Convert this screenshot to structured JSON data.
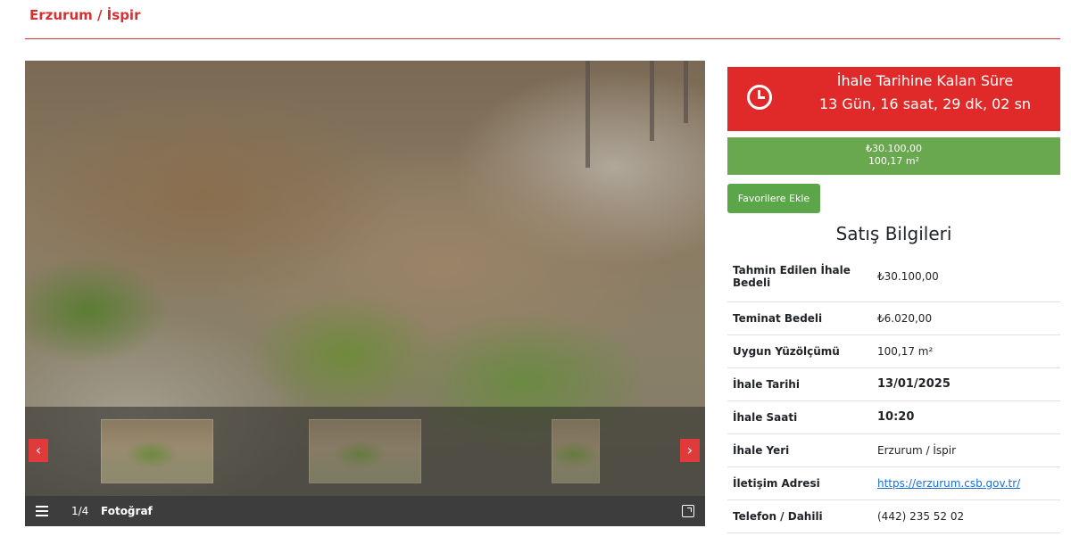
{
  "header": {
    "title": "Erzurum / İspir"
  },
  "gallery": {
    "counter": "1/4",
    "label": "Fotoğraf",
    "prev_icon": "‹",
    "next_icon": "›"
  },
  "countdown": {
    "title": "İhale Tarihine Kalan Süre",
    "time": "13 Gün, 16 saat, 29 dk, 02 sn"
  },
  "price": {
    "amount": "₺30.100,00",
    "area": "100,17 m²"
  },
  "favorite_button": {
    "label": "Favorilere Ekle"
  },
  "sale_info": {
    "title": "Satış Bilgileri",
    "rows": [
      {
        "key": "Tahmin Edilen İhale Bedeli",
        "value": "₺30.100,00"
      },
      {
        "key": "Teminat Bedeli",
        "value": "₺6.020,00"
      },
      {
        "key": "Uygun Yüzölçümü",
        "value": "100,17 m²"
      },
      {
        "key": "İhale Tarihi",
        "value": "13/01/2025"
      },
      {
        "key": "İhale Saati",
        "value": "10:20"
      },
      {
        "key": "İhale Yeri",
        "value": "Erzurum / İspir"
      },
      {
        "key": "İletişim Adresi",
        "value": "https://erzurum.csb.gov.tr/"
      },
      {
        "key": "Telefon / Dahili",
        "value": "(442) 235 52 02"
      }
    ]
  },
  "colors": {
    "accent_red": "#e02a2a",
    "accent_green": "#6aa84f",
    "link_blue": "#1a6fd6"
  }
}
